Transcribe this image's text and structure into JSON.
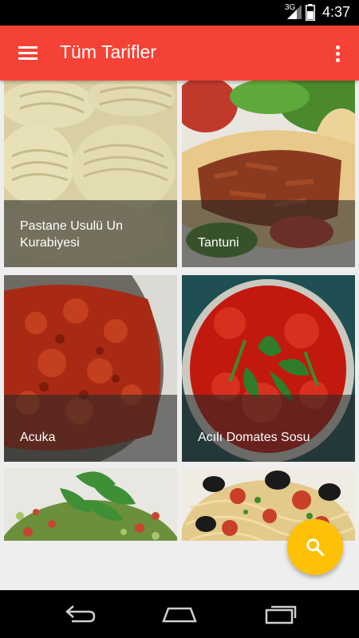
{
  "status_bar": {
    "network": "3G",
    "time": "4:37",
    "icons": [
      "signal-icon",
      "battery-icon"
    ]
  },
  "app_bar": {
    "title": "Tüm Tarifler",
    "icons": [
      "menu-icon",
      "overflow-icon"
    ],
    "color": "#f44336"
  },
  "recipes": [
    {
      "title": " Pastane Usulü Un Kurabiyesi",
      "image": "cookies-photo"
    },
    {
      "title": "Tantuni",
      "image": "wrap-photo"
    },
    {
      "title": "Acuka",
      "image": "red-paste-photo"
    },
    {
      "title": "Acılı Domates Sosu",
      "image": "tomato-sauce-photo"
    },
    {
      "title": "",
      "image": "herb-salad-photo"
    },
    {
      "title": "",
      "image": "pasta-photo"
    }
  ],
  "fab": {
    "icon": "search-icon",
    "color": "#ffc107"
  },
  "nav_bar": {
    "icons": [
      "back-icon",
      "home-icon",
      "recent-apps-icon"
    ]
  }
}
